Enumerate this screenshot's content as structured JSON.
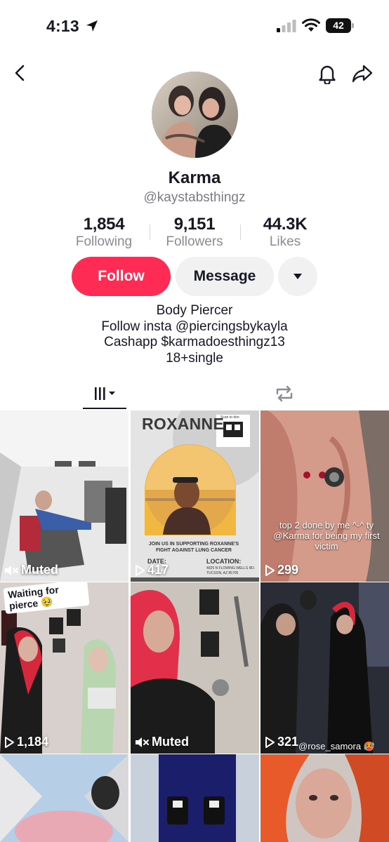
{
  "status_bar": {
    "time": "4:13",
    "battery": "42"
  },
  "profile": {
    "name": "Karma",
    "handle": "@kaystabsthingz",
    "stats": [
      {
        "value": "1,854",
        "label": "Following"
      },
      {
        "value": "9,151",
        "label": "Followers"
      },
      {
        "value": "44.3K",
        "label": "Likes"
      }
    ],
    "follow_label": "Follow",
    "message_label": "Message",
    "bio": [
      "Body Piercer",
      "Follow insta @piercingsbykayla",
      "Cashapp $karmadoesthingz13",
      "18+single"
    ]
  },
  "tabs": [
    {
      "icon": "grid-icon",
      "selected": true
    },
    {
      "icon": "repost-icon",
      "selected": false
    }
  ],
  "videos": [
    {
      "meta": "Muted",
      "meta_icon": "muted-icon"
    },
    {
      "meta": "417",
      "meta_icon": "play-icon",
      "poster_title": "ROXANNE",
      "poster_body": "JOIN US IN SUPPORTING ROXANNE'S FIGHT AGAINST LUNG CANCER",
      "poster_date_label": "DATE:",
      "poster_location_label": "LOCATION:",
      "poster_address": "4925 N FLOWING WELLS RD. TUCSON, AZ 85705",
      "poster_scan": "Scan to don"
    },
    {
      "meta": "299",
      "meta_icon": "play-icon",
      "caption": "top 2 done by me ^-^ ty @Karma for being my first victim"
    },
    {
      "meta": "1,184",
      "meta_icon": "play-icon",
      "caption": "Waiting for pierce 🥹"
    },
    {
      "meta": "Muted",
      "meta_icon": "muted-icon"
    },
    {
      "meta": "321",
      "meta_icon": "play-icon",
      "caption": "@rose_samora 🥵"
    },
    {
      "meta": "",
      "meta_icon": ""
    },
    {
      "meta": "",
      "meta_icon": ""
    },
    {
      "meta": "",
      "meta_icon": ""
    }
  ],
  "colors": {
    "follow": "#fe2c55",
    "secondary_button": "#f1f1f2",
    "muted_text": "#8a8b91"
  }
}
